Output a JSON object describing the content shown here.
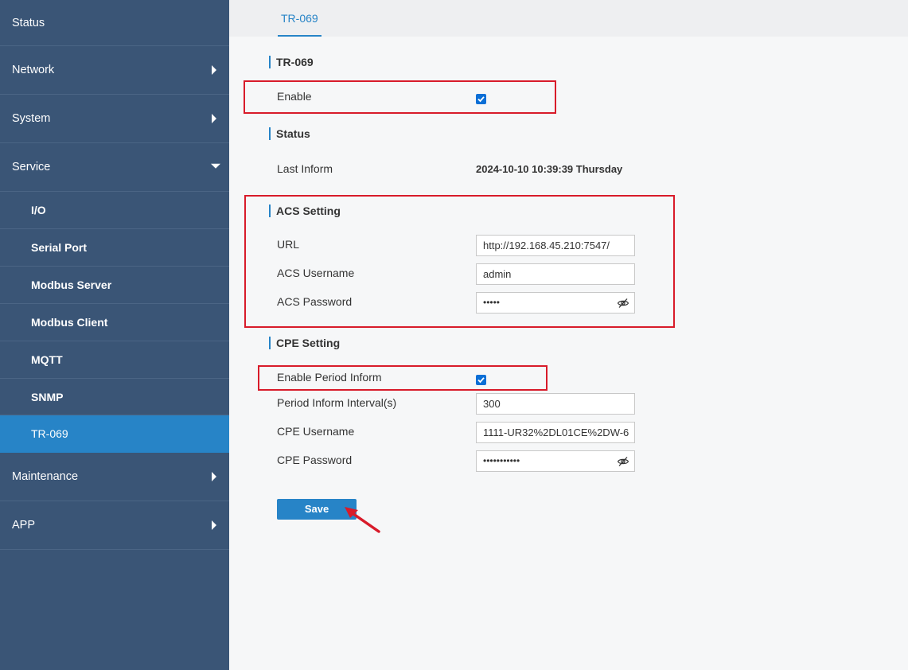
{
  "sidebar": {
    "items": [
      {
        "label": "Status"
      },
      {
        "label": "Network"
      },
      {
        "label": "System"
      },
      {
        "label": "Service"
      },
      {
        "label": "I/O"
      },
      {
        "label": "Serial Port"
      },
      {
        "label": "Modbus Server"
      },
      {
        "label": "Modbus Client"
      },
      {
        "label": "MQTT"
      },
      {
        "label": "SNMP"
      },
      {
        "label": "TR-069"
      },
      {
        "label": "Maintenance"
      },
      {
        "label": "APP"
      }
    ],
    "active_item": "TR-069"
  },
  "tabs": [
    {
      "label": "TR-069"
    }
  ],
  "sections": {
    "tr069": {
      "title": "TR-069",
      "enable_label": "Enable",
      "enable_checked": true
    },
    "status": {
      "title": "Status",
      "last_inform_label": "Last Inform",
      "last_inform_value": "2024-10-10 10:39:39 Thursday"
    },
    "acs": {
      "title": "ACS Setting",
      "url_label": "URL",
      "url_value": "http://192.168.45.210:7547/",
      "username_label": "ACS Username",
      "username_value": "admin",
      "password_label": "ACS Password",
      "password_dots": "•••••"
    },
    "cpe": {
      "title": "CPE Setting",
      "period_inform_label": "Enable Period Inform",
      "period_inform_checked": true,
      "interval_label": "Period Inform Interval(s)",
      "interval_value": "300",
      "username_label": "CPE Username",
      "username_value": "1111-UR32%2DL01CE%2DW-6",
      "password_label": "CPE Password",
      "password_dots": "•••••••••••"
    }
  },
  "buttons": {
    "save_label": "Save"
  },
  "icons": {
    "eye_off": "eye-off-icon",
    "check": "check-icon"
  },
  "colors": {
    "sidebar_bg": "#3a5576",
    "accent": "#2784c7",
    "highlight": "#d81b2a"
  }
}
